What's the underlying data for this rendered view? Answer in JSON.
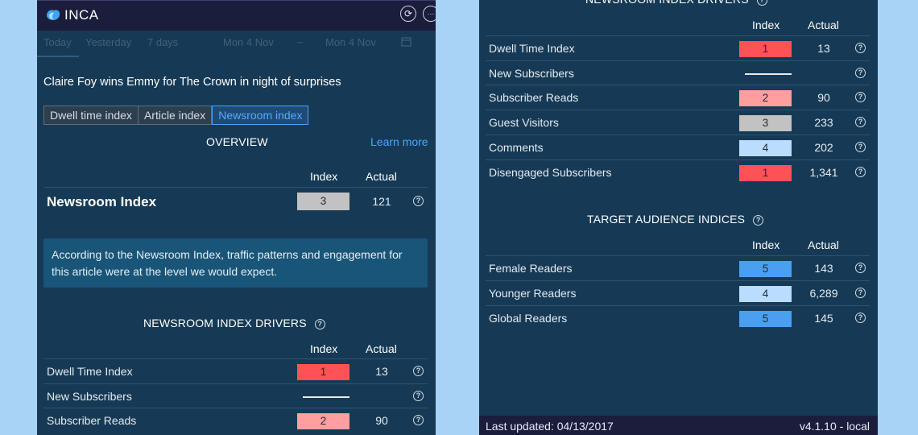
{
  "app": {
    "name": "INCA"
  },
  "colors": {
    "index_1": "#ff5256",
    "index_2": "#ff9e9e",
    "index_3": "#c2c2c2",
    "index_4": "#b9dcff",
    "index_5": "#4aa0f0",
    "accent": "#4ba7ff"
  },
  "window_buttons": [
    {
      "name": "refresh-icon",
      "glyph": "⟳"
    },
    {
      "name": "more-icon",
      "glyph": "···"
    },
    {
      "name": "close-icon",
      "glyph": "✕"
    }
  ],
  "date_tabs": {
    "today": "Today",
    "yesterday": "Yesterday",
    "seven_days": "7 days",
    "from": "Mon 4 Nov",
    "separator": "~",
    "to": "Mon 4 Nov"
  },
  "article_title": "Claire Foy wins Emmy for The Crown in night of surprises",
  "index_tabs": [
    "Dwell time index",
    "Article index",
    "Newsroom index"
  ],
  "active_tab": "Newsroom index",
  "overview": {
    "title": "OVERVIEW",
    "learn_more": "Learn more",
    "col_index": "Index",
    "col_actual": "Actual",
    "main_label": "Newsroom Index",
    "main_index": "3",
    "main_actual": "121",
    "info": "According to the Newsroom Index, traffic patterns and engagement for this article were at the level we would expect."
  },
  "drivers": {
    "title": "NEWSROOM INDEX DRIVERS",
    "col_index": "Index",
    "col_actual": "Actual",
    "rows": [
      {
        "label": "Dwell Time Index",
        "index": "1",
        "actual": "13"
      },
      {
        "label": "New Subscribers",
        "index": "",
        "actual": ""
      },
      {
        "label": "Subscriber Reads",
        "index": "2",
        "actual": "90"
      },
      {
        "label": "Guest Visitors",
        "index": "3",
        "actual": "233"
      },
      {
        "label": "Comments",
        "index": "4",
        "actual": "202"
      },
      {
        "label": "Disengaged Subscribers",
        "index": "1",
        "actual": "1,341"
      }
    ]
  },
  "target": {
    "title": "TARGET AUDIENCE INDICES",
    "col_index": "Index",
    "col_actual": "Actual",
    "rows": [
      {
        "label": "Female Readers",
        "index": "5",
        "actual": "143"
      },
      {
        "label": "Younger Readers",
        "index": "4",
        "actual": "6,289"
      },
      {
        "label": "Global Readers",
        "index": "5",
        "actual": "145"
      }
    ]
  },
  "footer": {
    "last_updated": "Last updated: 04/13/2017",
    "version": "v4.1.10 - local"
  }
}
